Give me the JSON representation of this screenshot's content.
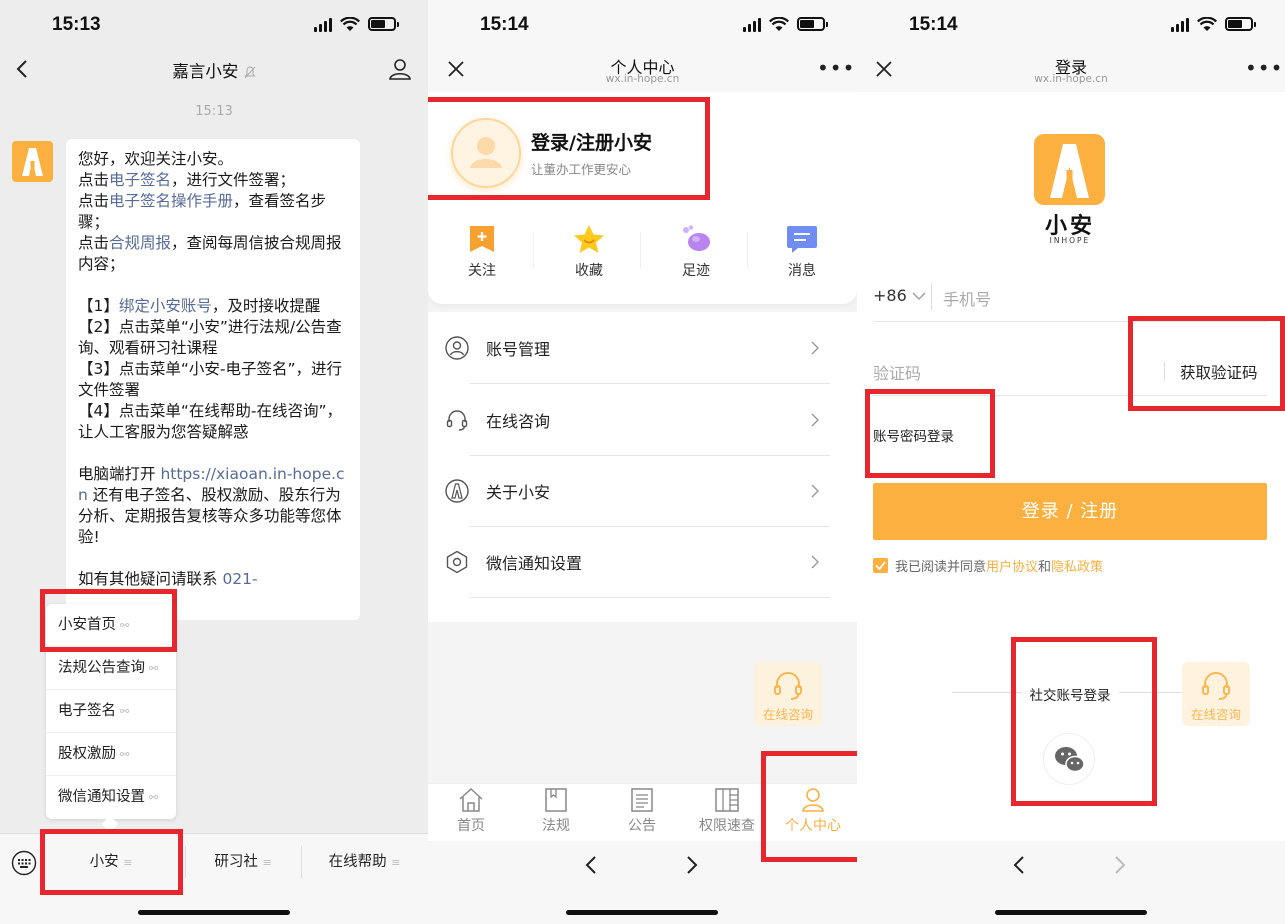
{
  "status": {
    "p1_time": "15:13",
    "p2_time": "15:14",
    "p3_time": "15:14"
  },
  "chat": {
    "title": "嘉言小安",
    "timestamp": "15:13",
    "bubble": {
      "l1": "您好，欢迎关注小安。",
      "l2_pre": "点击",
      "l2_link": "电子签名",
      "l2_post": "，进行文件签署；",
      "l3_pre": "点击",
      "l3_link": "电子签名操作手册",
      "l3_post": "，查看签名步骤；",
      "l4_pre": "点击",
      "l4_link": "合规周报",
      "l4_post": "，查阅每周信披合规周报内容；",
      "s1_pre": "【1】",
      "s1_link": "绑定小安账号",
      "s1_post": "，及时接收提醒",
      "s2": "【2】点击菜单“小安”进行法规/公告查询、观看研习社课程",
      "s3": "【3】点击菜单“小安-电子签名”，进行文件签署",
      "s4": "【4】点击菜单“在线帮助-在线咨询”，让人工客服为您答疑解惑",
      "pc_pre": "电脑端打开 ",
      "pc_link": "https://xiaoan.in-hope.cn",
      "pc_post": " 还有电子签名、股权激励、股东行为分析、定期报告复核等众多功能等您体验!",
      "contact_pre": " 如有其他疑问请联系 ",
      "contact_link": "021-"
    },
    "popup_menu": [
      "小安首页",
      "法规公告查询",
      "电子签名",
      "股权激励",
      "微信通知设置"
    ],
    "bottom_menu": [
      "小安",
      "研习社",
      "在线帮助"
    ],
    "menu_glyph": "≡"
  },
  "personal": {
    "title": "个人中心",
    "domain": "wx.in-hope.cn",
    "login_title": "登录/注册小安",
    "login_sub": "让董办工作更安心",
    "quick": [
      "关注",
      "收藏",
      "足迹",
      "消息"
    ],
    "rows": [
      "账号管理",
      "在线咨询",
      "关于小安",
      "微信通知设置"
    ],
    "float_label": "在线咨询",
    "tabs": [
      "首页",
      "法规",
      "公告",
      "权限速查",
      "个人中心"
    ]
  },
  "login": {
    "title": "登录",
    "domain": "wx.in-hope.cn",
    "logo_text": "小安",
    "logo_sub": "INHOPE",
    "country_code": "+86",
    "phone_placeholder": "手机号",
    "code_placeholder": "验证码",
    "get_code": "获取验证码",
    "pwd_login": "账号密码登录",
    "submit": "登录 / 注册",
    "agree_pre": "我已阅读并同意",
    "agree_link1": "用户协议",
    "agree_mid": "和",
    "agree_link2": "隐私政策",
    "social": "社交账号登录",
    "float_label": "在线咨询"
  },
  "colors": {
    "accent": "#fbb040",
    "link": "#576b95",
    "highlight": "#e8262d"
  }
}
